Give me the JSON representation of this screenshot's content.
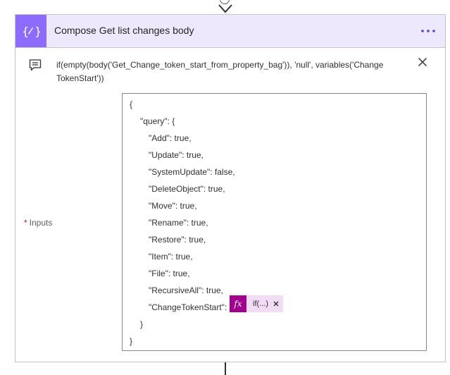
{
  "action": {
    "title": "Compose Get list changes body",
    "header_color": "#8c6cff",
    "header_bg": "#ede8fb",
    "icon": "curly-braces-icon",
    "more_icon": "more-dots-icon"
  },
  "expression": {
    "icon": "comment-icon",
    "text": "if(empty(body('Get_Change_token_start_from_property_bag')), 'null', variables('ChangeTokenStart'))",
    "close_icon": "close-icon"
  },
  "inputs": {
    "required_mark": "*",
    "label": "Inputs",
    "lines": [
      "{",
      "\"query\": {",
      "\"Add\": true,",
      "\"Update\": true,",
      "\"SystemUpdate\": false,",
      "\"DeleteObject\": true,",
      "\"Move\": true,",
      "\"Rename\": true,",
      "\"Restore\": true,",
      "\"Item\": true,",
      "\"File\": true,",
      "\"RecursiveAll\": true,",
      "\"ChangeTokenStart\":",
      "}",
      "}"
    ],
    "token": {
      "icon": "fx",
      "label": "if(...)",
      "color": "#a1008c",
      "bg": "#f1dcf4"
    }
  }
}
